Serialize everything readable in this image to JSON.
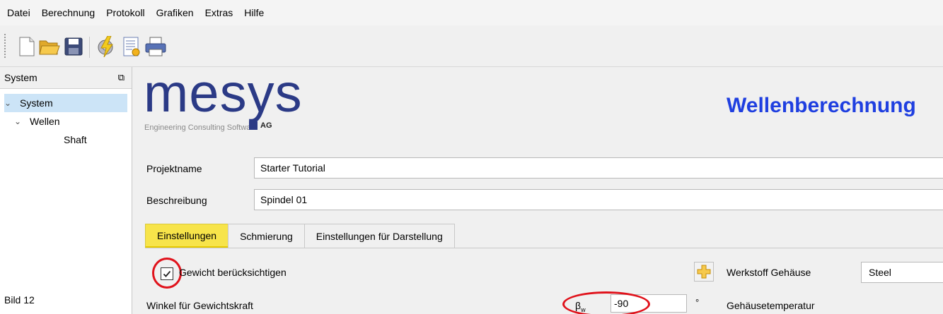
{
  "menu": [
    "Datei",
    "Berechnung",
    "Protokoll",
    "Grafiken",
    "Extras",
    "Hilfe"
  ],
  "toolbar": {
    "icons": [
      "new-file-icon",
      "open-folder-icon",
      "save-icon",
      "calculate-icon",
      "report-icon",
      "print-icon"
    ]
  },
  "sidebar": {
    "title": "System",
    "tree": [
      {
        "label": "System",
        "level": 0,
        "expanded": true,
        "selected": true
      },
      {
        "label": "Wellen",
        "level": 1,
        "expanded": true,
        "selected": false
      },
      {
        "label": "Shaft",
        "level": 2,
        "expanded": false,
        "selected": false
      }
    ],
    "caption": "Bild 12"
  },
  "header": {
    "logo": "mesys",
    "logo_subtitle": "Engineering Consulting Software",
    "logo_suffix": "AG",
    "app_title": "Wellenberechnung"
  },
  "project": {
    "name_label": "Projektname",
    "name_value": "Starter Tutorial",
    "desc_label": "Beschreibung",
    "desc_value": "Spindel 01"
  },
  "tabs": [
    {
      "label": "Einstellungen",
      "active": true
    },
    {
      "label": "Schmierung",
      "active": false
    },
    {
      "label": "Einstellungen für Darstellung",
      "active": false
    }
  ],
  "settings": {
    "weight_checkbox_label": "Gewicht berücksichtigen",
    "weight_checked": true,
    "angle_label": "Winkel für Gewichtskraft",
    "angle_symbol": "β",
    "angle_subscript": "w",
    "angle_value": "-90",
    "angle_unit": "°",
    "housing_material_label": "Werkstoff Gehäuse",
    "housing_material_value": "Steel",
    "housing_temp_label": "Gehäusetemperatur"
  },
  "colors": {
    "active_tab": "#f7e44a",
    "title_blue": "#1f3fe0",
    "logo_blue": "#2b3a86",
    "highlight_ring": "#e0121b",
    "selection": "#cce4f7"
  }
}
